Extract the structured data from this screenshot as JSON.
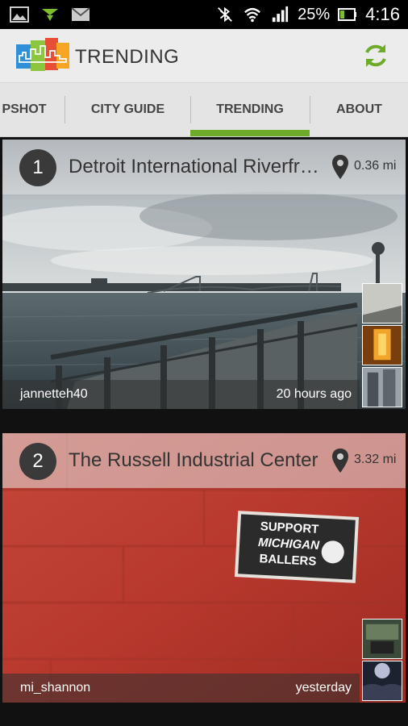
{
  "status_bar": {
    "battery_percent": "25%",
    "time": "4:16",
    "icons": [
      "gallery-icon",
      "download-arrow-icon",
      "gmail-icon",
      "bluetooth-icon",
      "wifi-icon",
      "signal-icon",
      "battery-icon"
    ]
  },
  "action_bar": {
    "title": "TRENDING",
    "logo_icon": "city-skyline-logo-icon",
    "refresh_icon": "refresh-icon",
    "accent_color": "#6eab2a"
  },
  "tabs": [
    {
      "label": "PSHOT",
      "selected": false
    },
    {
      "label": "CITY GUIDE",
      "selected": false
    },
    {
      "label": "TRENDING",
      "selected": true
    },
    {
      "label": "ABOUT",
      "selected": false
    }
  ],
  "cards": [
    {
      "rank": "1",
      "place": "Detroit International Riverfront",
      "distance": "0.36 mi",
      "user": "jannetteh40",
      "time_ago": "20 hours ago",
      "thumbnails": [
        "riverfront-photo-thumb",
        "sunset-photo-thumb",
        "building-photo-thumb"
      ]
    },
    {
      "rank": "2",
      "place": "The Russell Industrial Center",
      "distance": "3.32 mi",
      "user": "mi_shannon",
      "time_ago": "yesterday",
      "thumbnails": [
        "event-photo-thumb",
        "crowd-photo-thumb"
      ],
      "sign_text": [
        "SUPPORT",
        "MICHIGAN",
        "BALLERS"
      ]
    }
  ]
}
